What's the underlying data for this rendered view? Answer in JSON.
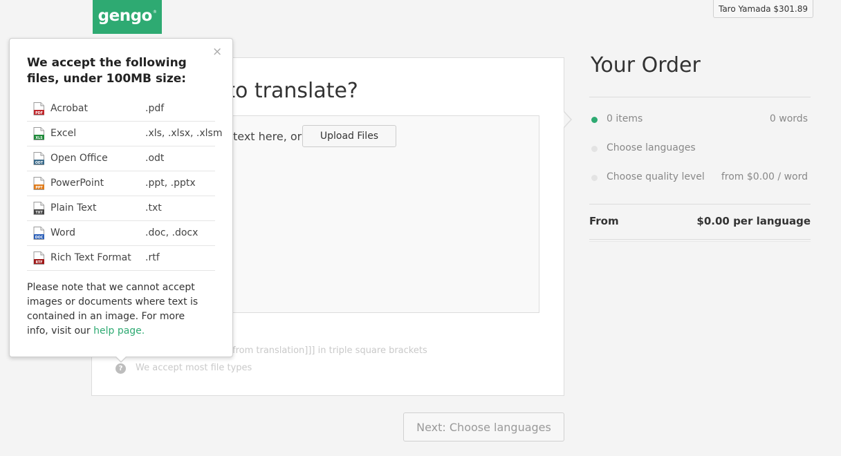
{
  "header": {
    "logo_text": "gengo",
    "logo_mark": "®",
    "account_label": "Taro Yamada $301.89"
  },
  "main": {
    "heading": "d you like to translate?",
    "paste_label": "text here, or",
    "upload_label": "Upload Files",
    "hint_brackets": "from translation]]] in triple square brackets",
    "hint_filetypes": "We accept most file types",
    "help_glyph": "?",
    "next_label": "Next: Choose languages"
  },
  "order": {
    "title": "Your Order",
    "rows": [
      {
        "label": "0 items",
        "value": "0 words",
        "active": true
      },
      {
        "label": "Choose languages",
        "value": "",
        "active": false
      },
      {
        "label": "Choose quality level",
        "value": "from $0.00 / word",
        "active": false
      }
    ],
    "total_label": "From",
    "total_value": "$0.00 per language"
  },
  "popover": {
    "close_glyph": "×",
    "title": "We accept the following files, under 100MB size:",
    "files": [
      {
        "name": "Acrobat",
        "ext": ".pdf",
        "tag": "PDF",
        "color": "#c0282d",
        "icon": "pdf-file-icon"
      },
      {
        "name": "Excel",
        "ext": ".xls, .xlsx, .xlsm",
        "tag": "XLS",
        "color": "#1f8a3a",
        "icon": "excel-file-icon"
      },
      {
        "name": "Open Office",
        "ext": ".odt",
        "tag": "ODT",
        "color": "#3a6a8a",
        "icon": "odt-file-icon"
      },
      {
        "name": "PowerPoint",
        "ext": ".ppt, .pptx",
        "tag": "PPT",
        "color": "#e07b1a",
        "icon": "ppt-file-icon"
      },
      {
        "name": "Plain Text",
        "ext": ".txt",
        "tag": "TXT",
        "color": "#444444",
        "icon": "txt-file-icon"
      },
      {
        "name": "Word",
        "ext": ".doc, .docx",
        "tag": "DOC",
        "color": "#2b5fb8",
        "icon": "word-file-icon"
      },
      {
        "name": "Rich Text Format",
        "ext": ".rtf",
        "tag": "RTF",
        "color": "#a01818",
        "icon": "rtf-file-icon"
      }
    ],
    "note_text": "Please note that we cannot accept images or documents where text is contained in an image. For more info, visit our ",
    "note_link": "help page."
  },
  "colors": {
    "brand_green": "#2eaa72",
    "background": "#f4f4f4"
  }
}
